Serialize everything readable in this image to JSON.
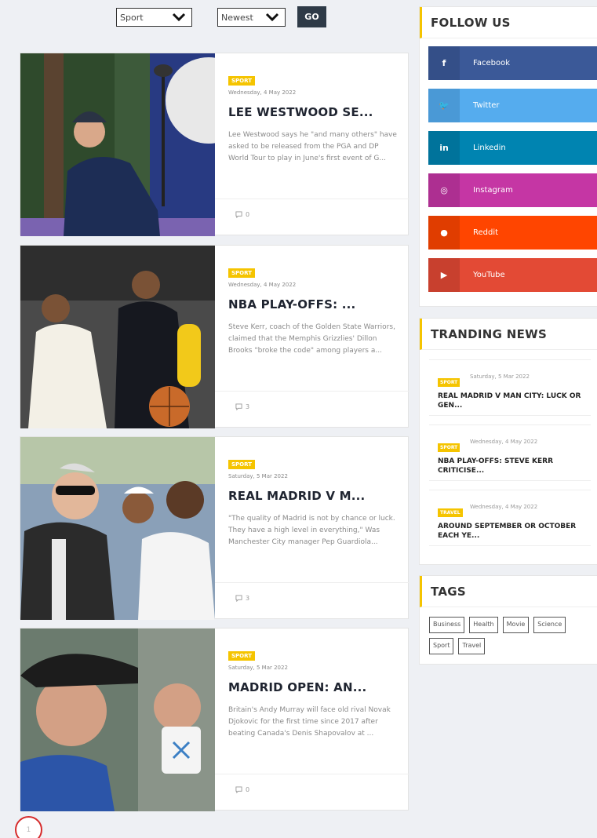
{
  "filters": {
    "category_selected": "Sport",
    "sort_selected": "Newest",
    "go_label": "GO"
  },
  "articles": [
    {
      "category": "SPORT",
      "date": "Wednesday, 4 May 2022",
      "title": "LEE WESTWOOD SE...",
      "excerpt": "Lee Westwood says he \"and many others\" have asked to be released from the PGA and DP World Tour to play in June's first event of G...",
      "comments": "0"
    },
    {
      "category": "SPORT",
      "date": "Wednesday, 4 May 2022",
      "title": "NBA PLAY-OFFS: ...",
      "excerpt": "Steve Kerr, coach of the Golden State Warriors, claimed that the Memphis Grizzlies' Dillon Brooks \"broke the code\" among players a...",
      "comments": "3"
    },
    {
      "category": "SPORT",
      "date": "Saturday, 5 Mar 2022",
      "title": "REAL MADRID V M...",
      "excerpt": "\"The quality of Madrid is not by chance or luck. They have a high level in everything,\" Was Manchester City manager Pep Guardiola...",
      "comments": "3"
    },
    {
      "category": "SPORT",
      "date": "Saturday, 5 Mar 2022",
      "title": "MADRID OPEN: AN...",
      "excerpt": "Britain's Andy Murray will face old rival Novak Djokovic for the first time since 2017 after beating Canada's Denis Shapovalov at ...",
      "comments": "0"
    }
  ],
  "pagination": {
    "current": "1"
  },
  "follow": {
    "title": "FOLLOW US",
    "items": [
      {
        "label": "Facebook",
        "icon": "facebook-icon",
        "glyph": "f"
      },
      {
        "label": "Twitter",
        "icon": "twitter-icon",
        "glyph": "🐦"
      },
      {
        "label": "Linkedin",
        "icon": "linkedin-icon",
        "glyph": "in"
      },
      {
        "label": "Instagram",
        "icon": "instagram-icon",
        "glyph": "◎"
      },
      {
        "label": "Reddit",
        "icon": "reddit-icon",
        "glyph": "●"
      },
      {
        "label": "YouTube",
        "icon": "youtube-icon",
        "glyph": "▶"
      }
    ]
  },
  "trending": {
    "title": "TRANDING NEWS",
    "items": [
      {
        "category": "SPORT",
        "date": "Saturday, 5 Mar 2022",
        "title": "REAL MADRID V MAN CITY: LUCK OR GEN..."
      },
      {
        "category": "SPORT",
        "date": "Wednesday, 4 May 2022",
        "title": "NBA PLAY-OFFS: STEVE KERR CRITICISE..."
      },
      {
        "category": "TRAVEL",
        "date": "Wednesday, 4 May 2022",
        "title": "AROUND SEPTEMBER OR OCTOBER EACH YE..."
      }
    ]
  },
  "tags": {
    "title": "TAGS",
    "items": [
      "Business",
      "Health",
      "Movie",
      "Science",
      "Sport",
      "Travel"
    ]
  },
  "colors": {
    "accent": "#f5c400",
    "dark_button": "#2e3a47",
    "pagination_ring": "#d62b2b"
  }
}
